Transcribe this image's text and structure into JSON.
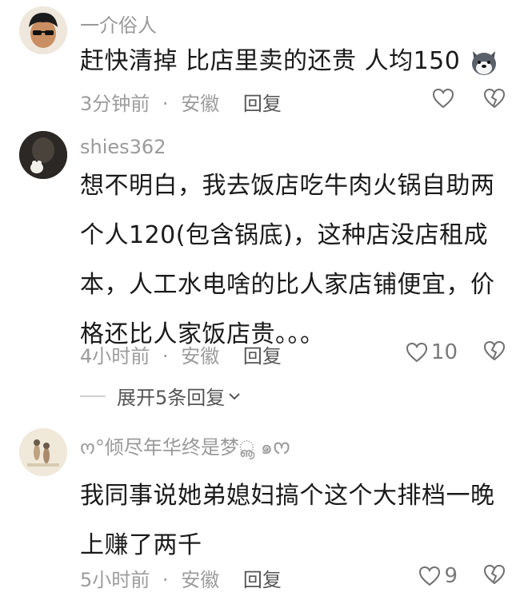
{
  "comments": [
    {
      "username": "一介俗人",
      "text": "赶快清掉 比店里卖的还贵 人均150",
      "time": "3分钟前",
      "region": "安徽",
      "reply_label": "回复",
      "likes": "",
      "emoji_icon": "husky-dog-emoji"
    },
    {
      "username": "shies362",
      "text_lines": [
        "想不明白，我去饭店吃牛肉火锅自助两",
        "个人120(包含锅底)，这种店没店租成",
        "本，人工水电啥的比人家店铺便宜，价",
        "格还比人家饭店贵。。。"
      ],
      "time": "4小时前",
      "region": "安徽",
      "reply_label": "回复",
      "likes": "10",
      "expand_label": "展开5条回复"
    },
    {
      "username": "ო°倾尽年华终是梦ൣ  ๑ᰔ",
      "text_lines": [
        "我同事说她弟媳妇搞个这个大排档一晚",
        "上赚了两千"
      ],
      "time": "5小时前",
      "region": "安徽",
      "reply_label": "回复",
      "likes": "9"
    }
  ],
  "meta_separator": "·"
}
